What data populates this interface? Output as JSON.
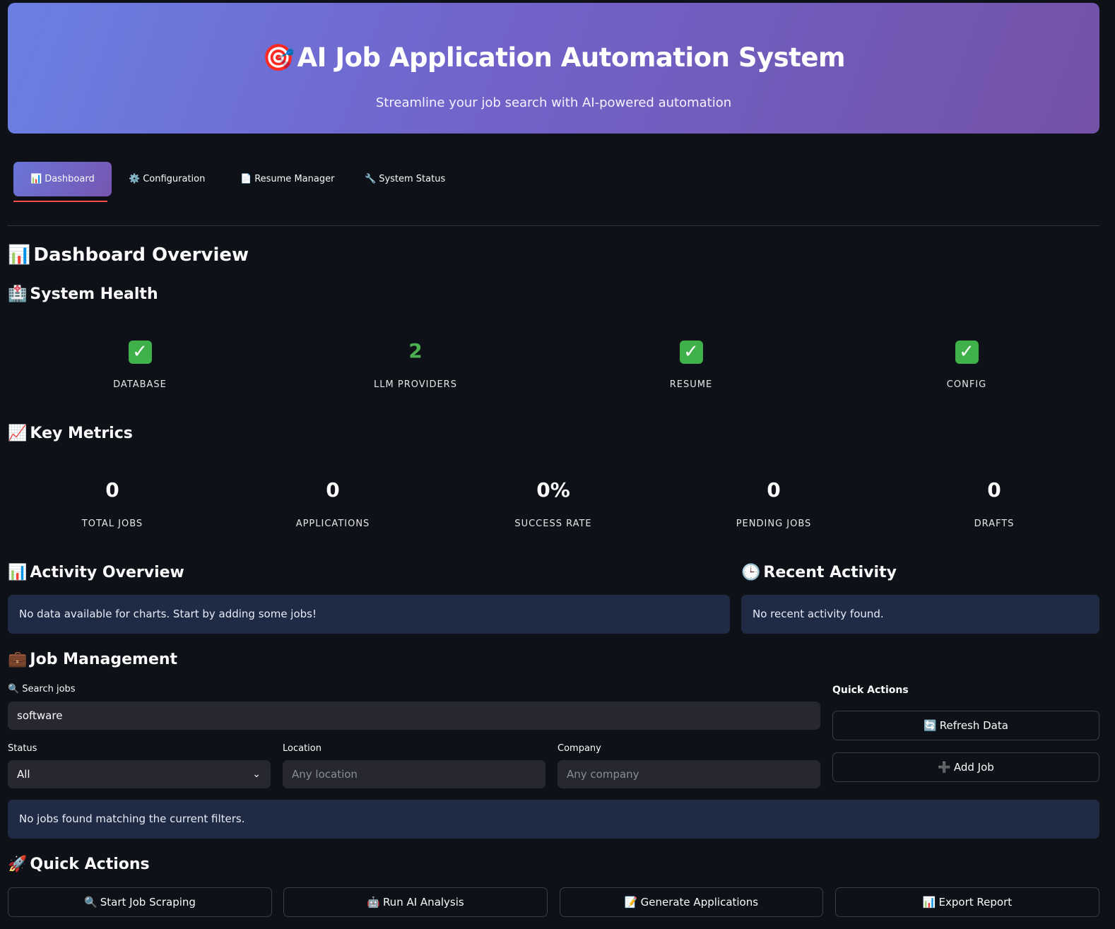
{
  "header": {
    "icon": "target-icon",
    "icon_glyph": "🎯",
    "title": "AI Job Application Automation System",
    "subtitle": "Streamline your job search with AI-powered automation"
  },
  "tabs": [
    {
      "icon": "chart-icon",
      "glyph": "📊",
      "label": "Dashboard",
      "active": true
    },
    {
      "icon": "gear-icon",
      "glyph": "⚙️",
      "label": "Configuration",
      "active": false
    },
    {
      "icon": "document-icon",
      "glyph": "📄",
      "label": "Resume Manager",
      "active": false
    },
    {
      "icon": "wrench-icon",
      "glyph": "🔧",
      "label": "System Status",
      "active": false
    }
  ],
  "dashboard": {
    "title_glyph": "📊",
    "title": "Dashboard Overview"
  },
  "system_health": {
    "title_glyph": "🏥",
    "title": "System Health",
    "items": [
      {
        "value": "✓",
        "label": "DATABASE"
      },
      {
        "value": "2",
        "label": "LLM PROVIDERS"
      },
      {
        "value": "✓",
        "label": "RESUME"
      },
      {
        "value": "✓",
        "label": "CONFIG"
      }
    ]
  },
  "key_metrics": {
    "title_glyph": "📈",
    "title": "Key Metrics",
    "items": [
      {
        "value": "0",
        "label": "TOTAL JOBS"
      },
      {
        "value": "0",
        "label": "APPLICATIONS"
      },
      {
        "value": "0%",
        "label": "SUCCESS RATE"
      },
      {
        "value": "0",
        "label": "PENDING JOBS"
      },
      {
        "value": "0",
        "label": "DRAFTS"
      }
    ]
  },
  "activity_overview": {
    "title_glyph": "📊",
    "title": "Activity Overview",
    "message": "No data available for charts. Start by adding some jobs!"
  },
  "recent_activity": {
    "title_glyph": "🕒",
    "title": "Recent Activity",
    "message": "No recent activity found."
  },
  "job_management": {
    "title_glyph": "💼",
    "title": "Job Management",
    "search_label_glyph": "🔍",
    "search_label": "Search jobs",
    "search_value": "software",
    "status_label": "Status",
    "status_value": "All",
    "location_label": "Location",
    "location_placeholder": "Any location",
    "company_label": "Company",
    "company_placeholder": "Any company",
    "empty_message": "No jobs found matching the current filters.",
    "quick_actions_label": "Quick Actions",
    "refresh_glyph": "🔄",
    "refresh_label": "Refresh Data",
    "add_glyph": "➕",
    "add_label": "Add Job"
  },
  "quick_actions": {
    "title_glyph": "🚀",
    "title": "Quick Actions",
    "buttons": [
      {
        "glyph": "🔍",
        "label": "Start Job Scraping"
      },
      {
        "glyph": "🤖",
        "label": "Run AI Analysis"
      },
      {
        "glyph": "📝",
        "label": "Generate Applications"
      },
      {
        "glyph": "📊",
        "label": "Export Report"
      }
    ]
  },
  "colors": {
    "background": "#0e1117",
    "accent_underline": "#ff4b4b",
    "info_box": "#1f2b44",
    "metric_green": "#4caf50"
  }
}
